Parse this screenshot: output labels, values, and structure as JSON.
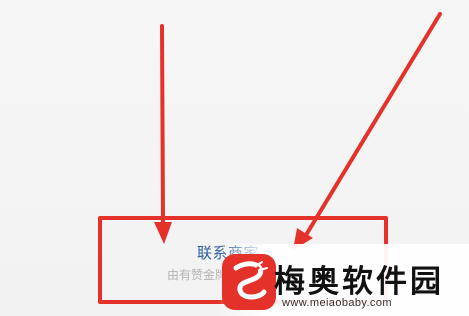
{
  "contact_item": {
    "title": "联系商家",
    "subtitle": "由有赞金牌客服提供"
  },
  "annotations": {
    "highlight_color": "#e4322b",
    "arrow_color": "#e4322b"
  },
  "watermark": {
    "logo_icon": "dragon-s-logo",
    "logo_color": "#e4322b",
    "site_name": "梅奥软件园",
    "site_url": "www.meiaobaby.com"
  }
}
